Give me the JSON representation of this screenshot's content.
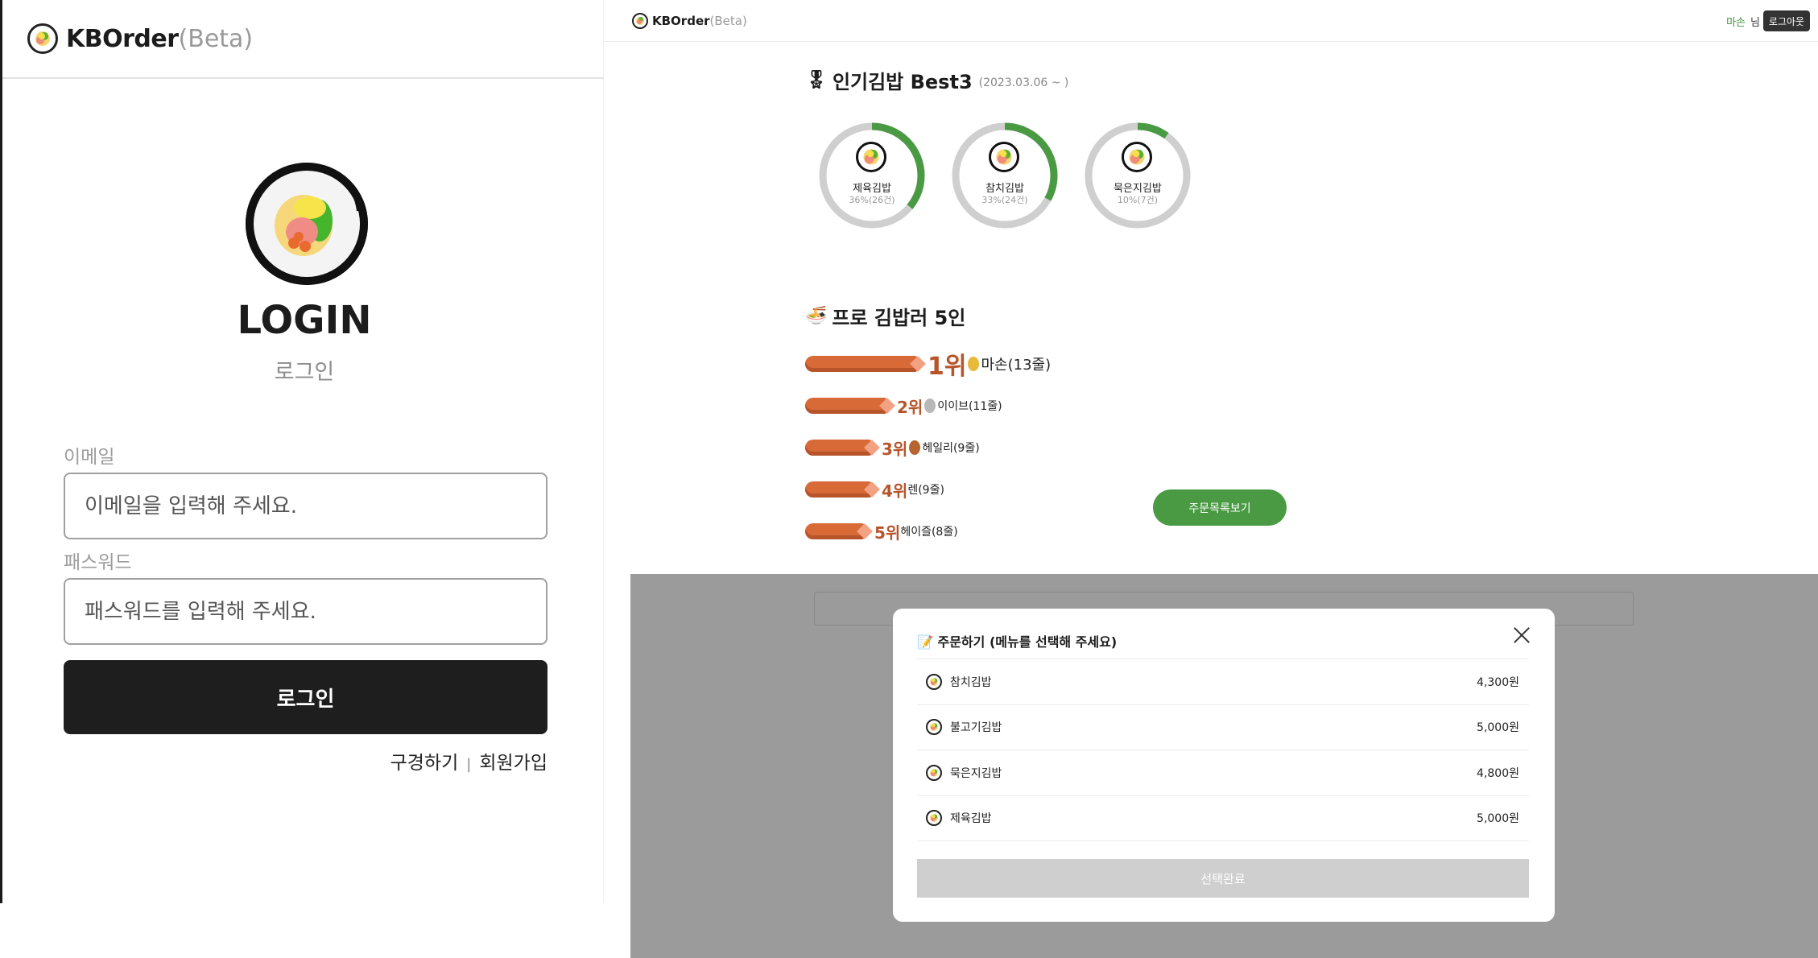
{
  "login_page": {
    "brand": {
      "name": "KBOrder",
      "beta": "(Beta)"
    },
    "title": "LOGIN",
    "subtitle": "로그인",
    "email": {
      "label": "이메일",
      "placeholder": "이메일을 입력해 주세요."
    },
    "password": {
      "label": "패스워드",
      "placeholder": "패스워드를 입력해 주세요."
    },
    "submit_label": "로그인",
    "links": {
      "browse": "구경하기",
      "separator": "|",
      "signup": "회원가입"
    }
  },
  "dashboard": {
    "brand": {
      "name": "KBOrder",
      "beta": "(Beta)"
    },
    "user": {
      "name": "마손",
      "suffix": "님"
    },
    "logout_label": "로그아웃",
    "popular": {
      "emoji": "🎖",
      "title": "인기김밥 Best3",
      "since": "(2023.03.06 ~ )",
      "items": [
        {
          "name": "제육김밥",
          "stat": "36%(26건)",
          "percent": 36
        },
        {
          "name": "참치김밥",
          "stat": "33%(24건)",
          "percent": 33
        },
        {
          "name": "묵은지김밥",
          "stat": "10%(7건)",
          "percent": 10
        }
      ]
    },
    "ranking": {
      "emoji": "🍜",
      "title": "프로 김밥러 5인",
      "items": [
        {
          "rank": "1위",
          "medal": "gold",
          "who": "마손(13줄)",
          "rolls": 13
        },
        {
          "rank": "2위",
          "medal": "silver",
          "who": "이이브(11줄)",
          "rolls": 11
        },
        {
          "rank": "3위",
          "medal": "bronze",
          "who": "헤일리(9줄)",
          "rolls": 9
        },
        {
          "rank": "4위",
          "medal": "",
          "who": "렌(9줄)",
          "rolls": 9
        },
        {
          "rank": "5위",
          "medal": "",
          "who": "헤이즐(8줄)",
          "rolls": 8
        }
      ]
    },
    "order_list_button": "주문목록보기"
  },
  "order_modal": {
    "title": "📝 주문하기 (메뉴를 선택해 주세요)",
    "menu": [
      {
        "name": "참치김밥",
        "price": "4,300원"
      },
      {
        "name": "불고기김밥",
        "price": "5,000원"
      },
      {
        "name": "묵은지김밥",
        "price": "4,800원"
      },
      {
        "name": "제육김밥",
        "price": "5,000원"
      }
    ],
    "submit_label": "선택완료"
  },
  "colors": {
    "accent_green": "#4a9a44",
    "rank_orange": "#d86a38",
    "rank_text": "#b8542a",
    "dark_button": "#1e1e1e",
    "overlay": "#9b9b9b"
  }
}
